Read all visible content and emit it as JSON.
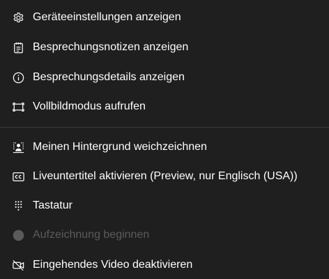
{
  "menu": {
    "items": [
      {
        "label": "Geräteeinstellungen anzeigen",
        "icon": "gear-icon",
        "enabled": true
      },
      {
        "label": "Besprechungsnotizen anzeigen",
        "icon": "notes-icon",
        "enabled": true
      },
      {
        "label": "Besprechungsdetails anzeigen",
        "icon": "info-icon",
        "enabled": true
      },
      {
        "label": "Vollbildmodus aufrufen",
        "icon": "fullscreen-icon",
        "enabled": true
      },
      {
        "label": "Meinen Hintergrund weichzeichnen",
        "icon": "blur-background-icon",
        "enabled": true
      },
      {
        "label": "Liveuntertitel aktivieren (Preview, nur Englisch (USA))",
        "icon": "closed-captions-icon",
        "enabled": true
      },
      {
        "label": "Tastatur",
        "icon": "dialpad-icon",
        "enabled": true
      },
      {
        "label": "Aufzeichnung beginnen",
        "icon": "record-icon",
        "enabled": false
      },
      {
        "label": "Eingehendes Video deaktivieren",
        "icon": "video-off-icon",
        "enabled": true
      }
    ]
  },
  "colors": {
    "background": "#201f1f",
    "text": "#ffffff",
    "disabled_text": "#5c5b5a",
    "divider": "#3b3a39"
  }
}
